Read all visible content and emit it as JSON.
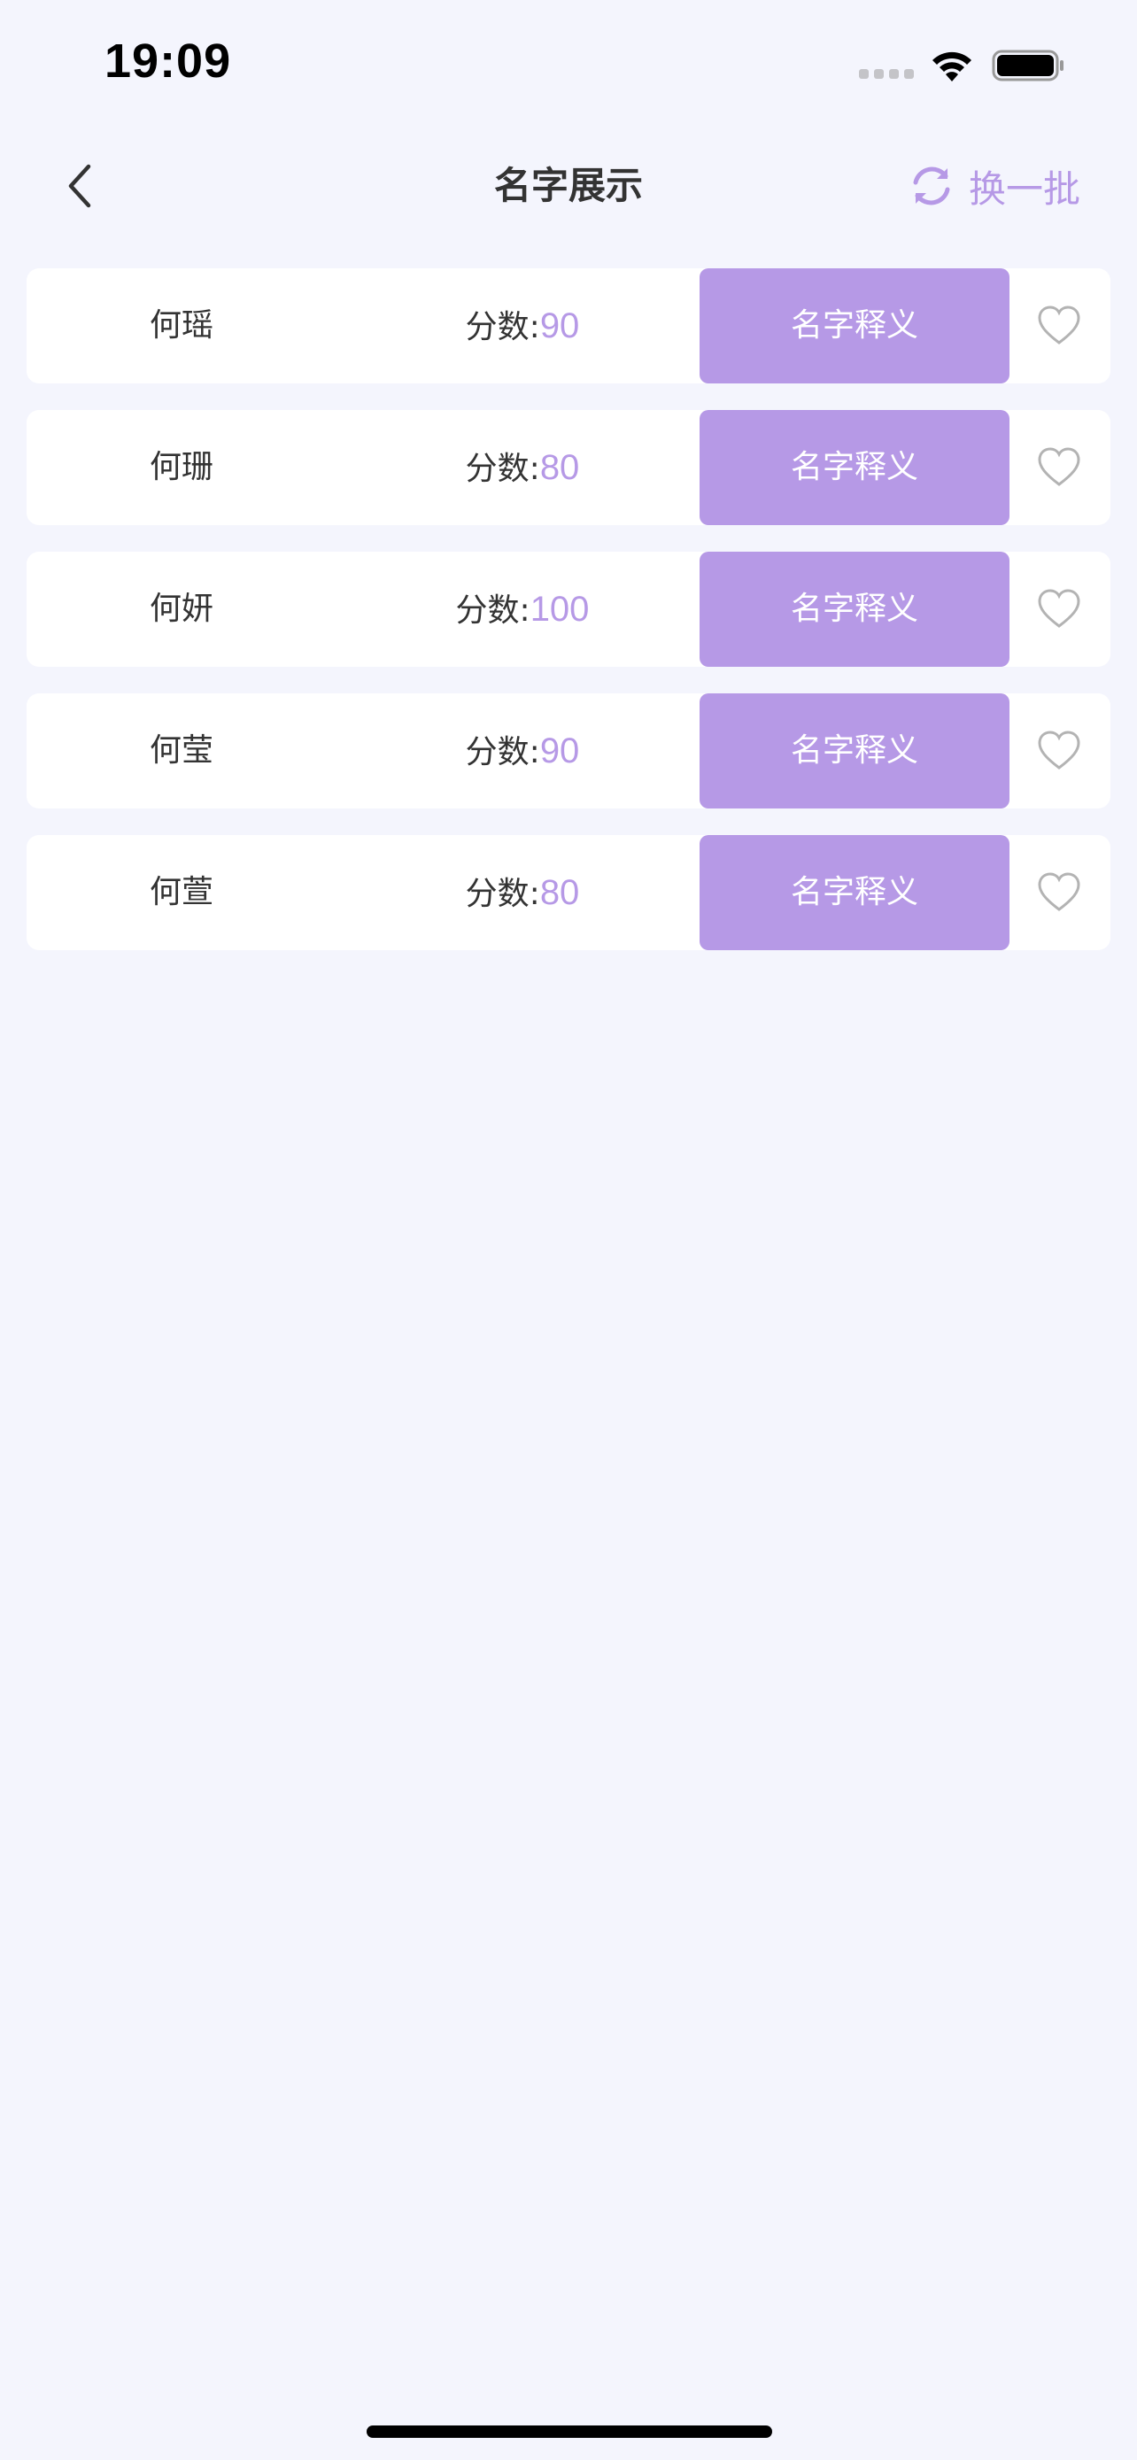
{
  "status_bar": {
    "time": "19:09",
    "signal_icon": "cellular-signal-icon",
    "wifi_icon": "wifi-icon",
    "battery_icon": "battery-icon"
  },
  "nav": {
    "back_icon": "chevron-left-icon",
    "title": "名字展示",
    "refresh_label": "换一批",
    "refresh_icon": "refresh-icon"
  },
  "colors": {
    "accent": "#b699e6",
    "background": "#f4f5fd",
    "card": "#ffffff",
    "text": "#333333"
  },
  "names": [
    {
      "name": "何瑶",
      "score_label": "分数:",
      "score": "90",
      "button_label": "名字释义",
      "favorited": false
    },
    {
      "name": "何珊",
      "score_label": "分数:",
      "score": "80",
      "button_label": "名字释义",
      "favorited": false
    },
    {
      "name": "何妍",
      "score_label": "分数:",
      "score": "100",
      "button_label": "名字释义",
      "favorited": false
    },
    {
      "name": "何莹",
      "score_label": "分数:",
      "score": "90",
      "button_label": "名字释义",
      "favorited": false
    },
    {
      "name": "何萱",
      "score_label": "分数:",
      "score": "80",
      "button_label": "名字释义",
      "favorited": false
    }
  ]
}
